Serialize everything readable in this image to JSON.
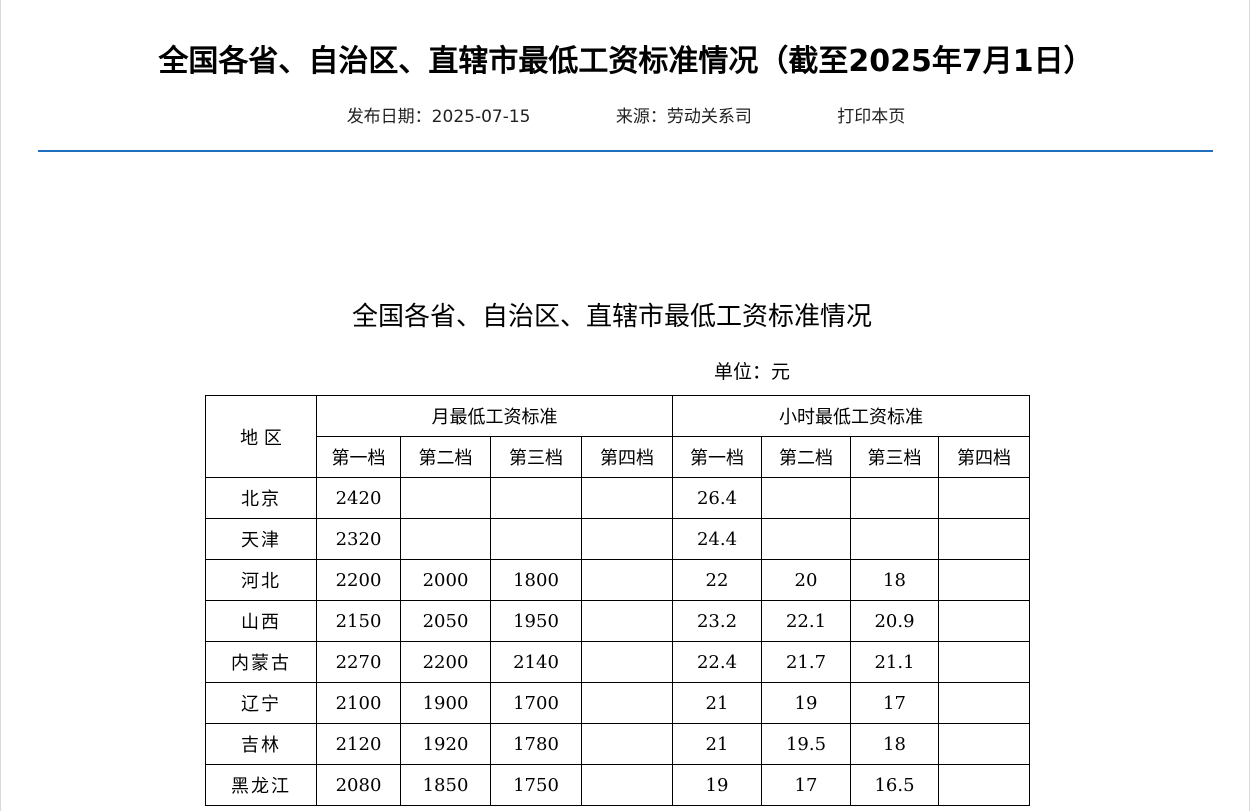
{
  "page": {
    "title": "全国各省、自治区、直辖市最低工资标准情况（截至2025年7月1日）",
    "publish_date": "发布日期：2025-07-15",
    "source": "来源：劳动关系司",
    "print_label": "打印本页"
  },
  "document": {
    "title": "全国各省、自治区、直辖市最低工资标准情况",
    "unit": "单位：元",
    "table": {
      "region_header": "地 区",
      "monthly_header": "月最低工资标准",
      "hourly_header": "小时最低工资标准",
      "tiers": [
        "第一档",
        "第二档",
        "第三档",
        "第四档",
        "第一档",
        "第二档",
        "第三档",
        "第四档"
      ],
      "rows": [
        {
          "region": "北京",
          "monthly": [
            "2420",
            "",
            "",
            ""
          ],
          "hourly": [
            "26.4",
            "",
            "",
            ""
          ]
        },
        {
          "region": "天津",
          "monthly": [
            "2320",
            "",
            "",
            ""
          ],
          "hourly": [
            "24.4",
            "",
            "",
            ""
          ]
        },
        {
          "region": "河北",
          "monthly": [
            "2200",
            "2000",
            "1800",
            ""
          ],
          "hourly": [
            "22",
            "20",
            "18",
            ""
          ]
        },
        {
          "region": "山西",
          "monthly": [
            "2150",
            "2050",
            "1950",
            ""
          ],
          "hourly": [
            "23.2",
            "22.1",
            "20.9",
            ""
          ]
        },
        {
          "region": "内蒙古",
          "monthly": [
            "2270",
            "2200",
            "2140",
            ""
          ],
          "hourly": [
            "22.4",
            "21.7",
            "21.1",
            ""
          ]
        },
        {
          "region": "辽宁",
          "monthly": [
            "2100",
            "1900",
            "1700",
            ""
          ],
          "hourly": [
            "21",
            "19",
            "17",
            ""
          ]
        },
        {
          "region": "吉林",
          "monthly": [
            "2120",
            "1920",
            "1780",
            ""
          ],
          "hourly": [
            "21",
            "19.5",
            "18",
            ""
          ]
        },
        {
          "region": "黑龙江",
          "monthly": [
            "2080",
            "1850",
            "1750",
            ""
          ],
          "hourly": [
            "19",
            "17",
            "16.5",
            ""
          ]
        }
      ]
    }
  },
  "colors": {
    "divider": "#1f6fbe",
    "border": "#000000"
  }
}
